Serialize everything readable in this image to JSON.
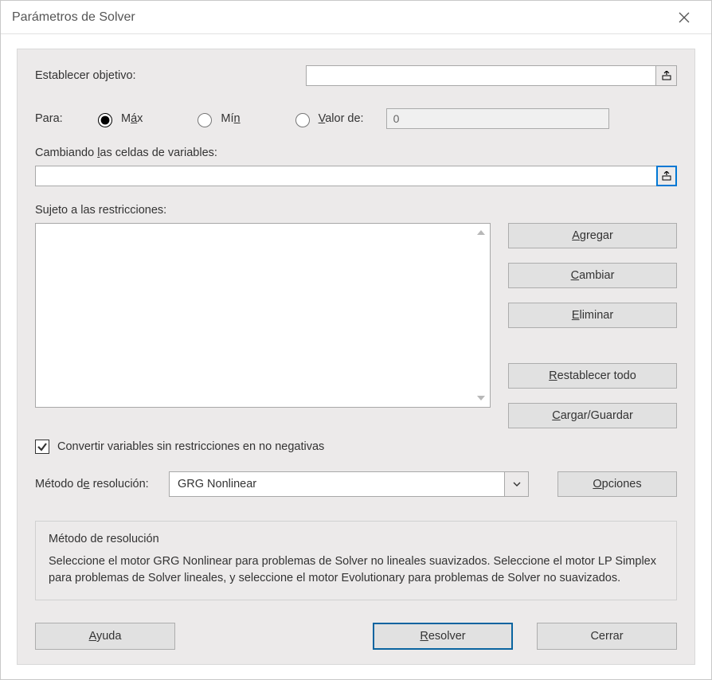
{
  "window": {
    "title": "Parámetros de Solver"
  },
  "labels": {
    "set_objective": "Establecer objetivo:",
    "para": "Para:",
    "max_pre": "M",
    "max_u": "á",
    "max_post": "x",
    "min_pre": "Mí",
    "min_u": "n",
    "min_post": "",
    "valde_pre": "",
    "valde_u": "V",
    "valde_post": "alor de:",
    "changing_pre": "Cambiando ",
    "changing_u": "l",
    "changing_post": "as celdas de variables:",
    "constraints": "Sujeto a las restricciones:",
    "nonneg": "Convertir variables sin restricciones en no negativas",
    "method_pre": "Método d",
    "method_u": "e",
    "method_post": " resolución:"
  },
  "inputs": {
    "objective": "",
    "value_of": "0",
    "changing": "",
    "method_selected": "GRG Nonlinear"
  },
  "buttons": {
    "add_u": "A",
    "add_post": "gregar",
    "change_u": "C",
    "change_post": "ambiar",
    "delete_u": "E",
    "delete_post": "liminar",
    "reset_u": "R",
    "reset_post": "establecer todo",
    "load_u": "C",
    "load_post": "argar/Guardar",
    "options_u": "O",
    "options_post": "pciones",
    "help_u": "A",
    "help_post": "yuda",
    "solve_u": "R",
    "solve_post": "esolver",
    "close": "Cerrar"
  },
  "helpbox": {
    "title": "Método de resolución",
    "text": "Seleccione el motor GRG Nonlinear para problemas de Solver no lineales suavizados. Seleccione el motor LP Simplex para problemas de Solver lineales, y seleccione el motor Evolutionary para problemas de Solver no suavizados."
  },
  "state": {
    "selected_radio": "max",
    "nonneg_checked": true
  }
}
